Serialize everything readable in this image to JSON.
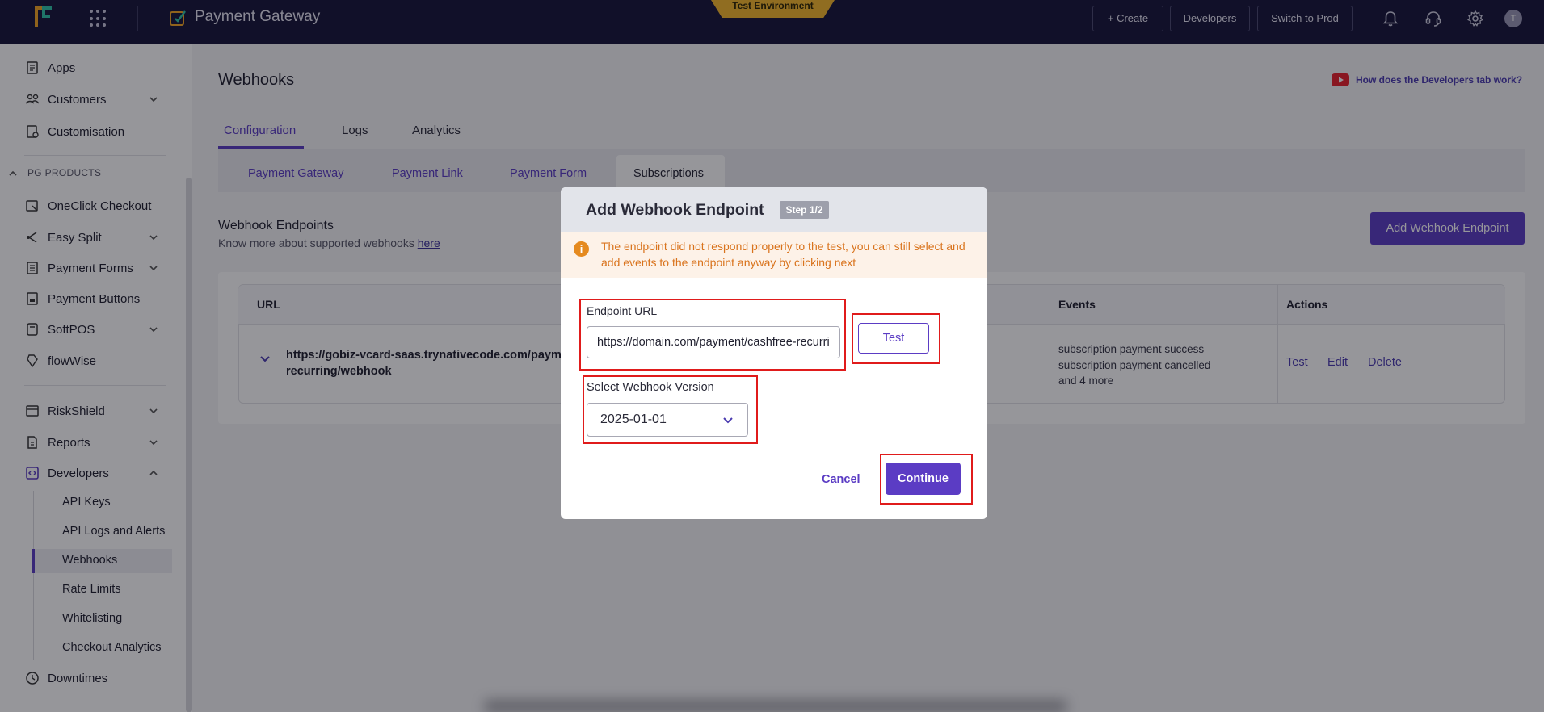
{
  "topbar": {
    "app_title": "Payment Gateway",
    "environment_badge": "Test Environment",
    "create_label": "+ Create",
    "developers_label": "Developers",
    "switch_label": "Switch to Prod",
    "avatar_initial": "T",
    "icons": [
      "apps-grid-icon",
      "bell-icon",
      "headset-icon",
      "gear-icon"
    ]
  },
  "sidebar": {
    "items": [
      {
        "label": "Apps",
        "icon": "apps-icon"
      },
      {
        "label": "Customers",
        "icon": "users-icon",
        "expandable": true
      },
      {
        "label": "Customisation",
        "icon": "customisation-icon"
      }
    ],
    "section_label": "PG PRODUCTS",
    "products": [
      {
        "label": "OneClick Checkout",
        "icon": "checkout-icon"
      },
      {
        "label": "Easy Split",
        "icon": "split-icon",
        "expandable": true
      },
      {
        "label": "Payment Forms",
        "icon": "form-icon",
        "expandable": true
      },
      {
        "label": "Payment Buttons",
        "icon": "button-icon"
      },
      {
        "label": "SoftPOS",
        "icon": "pos-icon",
        "expandable": true
      },
      {
        "label": "flowWise",
        "icon": "flow-icon"
      }
    ],
    "tools": [
      {
        "label": "RiskShield",
        "icon": "shield-icon",
        "expandable": true
      },
      {
        "label": "Reports",
        "icon": "report-icon",
        "expandable": true
      },
      {
        "label": "Developers",
        "icon": "developers-icon",
        "expanded": true
      }
    ],
    "developer_subitems": [
      "API Keys",
      "API Logs and Alerts",
      "Webhooks",
      "Rate Limits",
      "Whitelisting",
      "Checkout Analytics"
    ],
    "active_subitem": "Webhooks",
    "downtimes_label": "Downtimes"
  },
  "main": {
    "page_title": "Webhooks",
    "help_link": "How does the Developers tab work?",
    "tabs": [
      "Configuration",
      "Logs",
      "Analytics"
    ],
    "active_tab": "Configuration",
    "subtabs": [
      "Payment Gateway",
      "Payment Link",
      "Payment Form",
      "Subscriptions"
    ],
    "active_subtab": "Subscriptions",
    "section_title": "Webhook Endpoints",
    "section_subtitle": "Know more about supported webhooks ",
    "section_link": "here",
    "add_button": "Add Webhook Endpoint",
    "table": {
      "headers": [
        "URL",
        "Events",
        "Actions"
      ],
      "rows": [
        {
          "url_line1": "https://gobiz-vcard-saas.trynativecode.com/payment",
          "url_line2": "recurring/webhook",
          "events": [
            "subscription payment success",
            "subscription payment cancelled",
            "and 4 more"
          ],
          "actions": [
            "Test",
            "Edit",
            "Delete"
          ]
        }
      ]
    }
  },
  "modal": {
    "title": "Add Webhook Endpoint",
    "step": "Step 1/2",
    "warning": "The endpoint did not respond properly to the test, you can still select and add events to the endpoint anyway by clicking next",
    "endpoint_label": "Endpoint URL",
    "endpoint_value": "https://domain.com/payment/cashfree-recurring/webhook",
    "test_label": "Test",
    "version_label": "Select Webhook Version",
    "version_value": "2025-01-01",
    "cancel_label": "Cancel",
    "continue_label": "Continue"
  },
  "colors": {
    "topbar_bg": "#161439",
    "accent": "#5b3cc4",
    "warning": "#d9731c",
    "highlight": "#e01b1b"
  }
}
